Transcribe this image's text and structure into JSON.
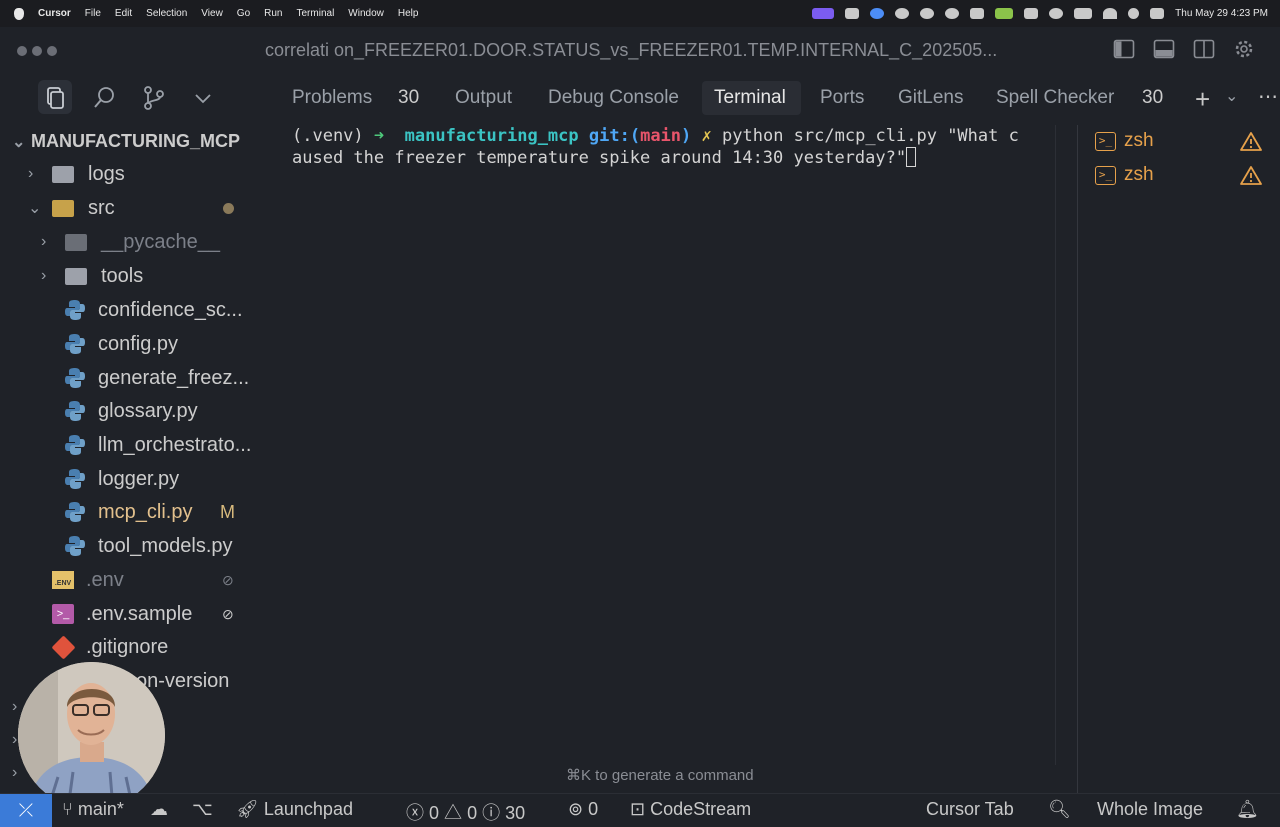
{
  "menubar": {
    "apple": "",
    "app_name": "Cursor",
    "menus": [
      "File",
      "Edit",
      "Selection",
      "View",
      "Go",
      "Run",
      "Terminal",
      "Window",
      "Help"
    ],
    "clock": "Thu May 29  4:23 PM"
  },
  "window": {
    "title": "correlati on_FREEZER01.DOOR.STATUS_vs_FREEZER01.TEMP.INTERNAL_C_202505..."
  },
  "explorer": {
    "project": "MANUFACTURING_MCP",
    "items": [
      {
        "label": "logs",
        "kind": "folder"
      },
      {
        "label": "src",
        "kind": "folder-open"
      },
      {
        "label": "__pycache__",
        "kind": "folder"
      },
      {
        "label": "tools",
        "kind": "folder"
      },
      {
        "label": "confidence_sc...",
        "kind": "python"
      },
      {
        "label": "config.py",
        "kind": "python"
      },
      {
        "label": "generate_freez...",
        "kind": "python"
      },
      {
        "label": "glossary.py",
        "kind": "python"
      },
      {
        "label": "llm_orchestrato...",
        "kind": "python"
      },
      {
        "label": "logger.py",
        "kind": "python"
      },
      {
        "label": "mcp_cli.py",
        "kind": "python",
        "badge": "M"
      },
      {
        "label": "tool_models.py",
        "kind": "python"
      },
      {
        "label": ".env",
        "kind": "env"
      },
      {
        "label": ".env.sample",
        "kind": "shell"
      },
      {
        "label": ".gitignore",
        "kind": "git"
      },
      {
        "label": "on-version",
        "kind": "file"
      }
    ]
  },
  "panel": {
    "tabs": [
      {
        "label": "Problems",
        "count": "30"
      },
      {
        "label": "Output"
      },
      {
        "label": "Debug Console"
      },
      {
        "label": "Terminal",
        "active": true
      },
      {
        "label": "Ports"
      },
      {
        "label": "GitLens"
      },
      {
        "label": "Spell Checker",
        "count": "30"
      }
    ]
  },
  "terminal": {
    "venv": "(.venv)",
    "arrow": "➜",
    "dir": "manufacturing_mcp",
    "git_prefix": "git:(",
    "branch": "main",
    "git_suffix": ")",
    "dirty": "✗",
    "command_line1": "python src/mcp_cli.py \"What c",
    "command_line2": "aused the freezer temperature spike around 14:30 yesterday?\"",
    "hint": "⌘K to generate a command",
    "sessions": [
      "zsh",
      "zsh"
    ]
  },
  "statusbar": {
    "branch": "main*",
    "launchpad": "Launchpad",
    "errors": "0",
    "warnings": "0",
    "infos": "30",
    "ports": "0",
    "codestream": "CodeStream",
    "cursor_tab": "Cursor Tab",
    "whole_image": "Whole Image"
  },
  "colors": {
    "accent": "#3b7bd8",
    "folder_open": "#c7a24a",
    "terminal_cyan": "#3bc4c4",
    "terminal_red": "#e8556b",
    "zsh_orange": "#e6a14b",
    "modified": "#d7ba7d"
  }
}
